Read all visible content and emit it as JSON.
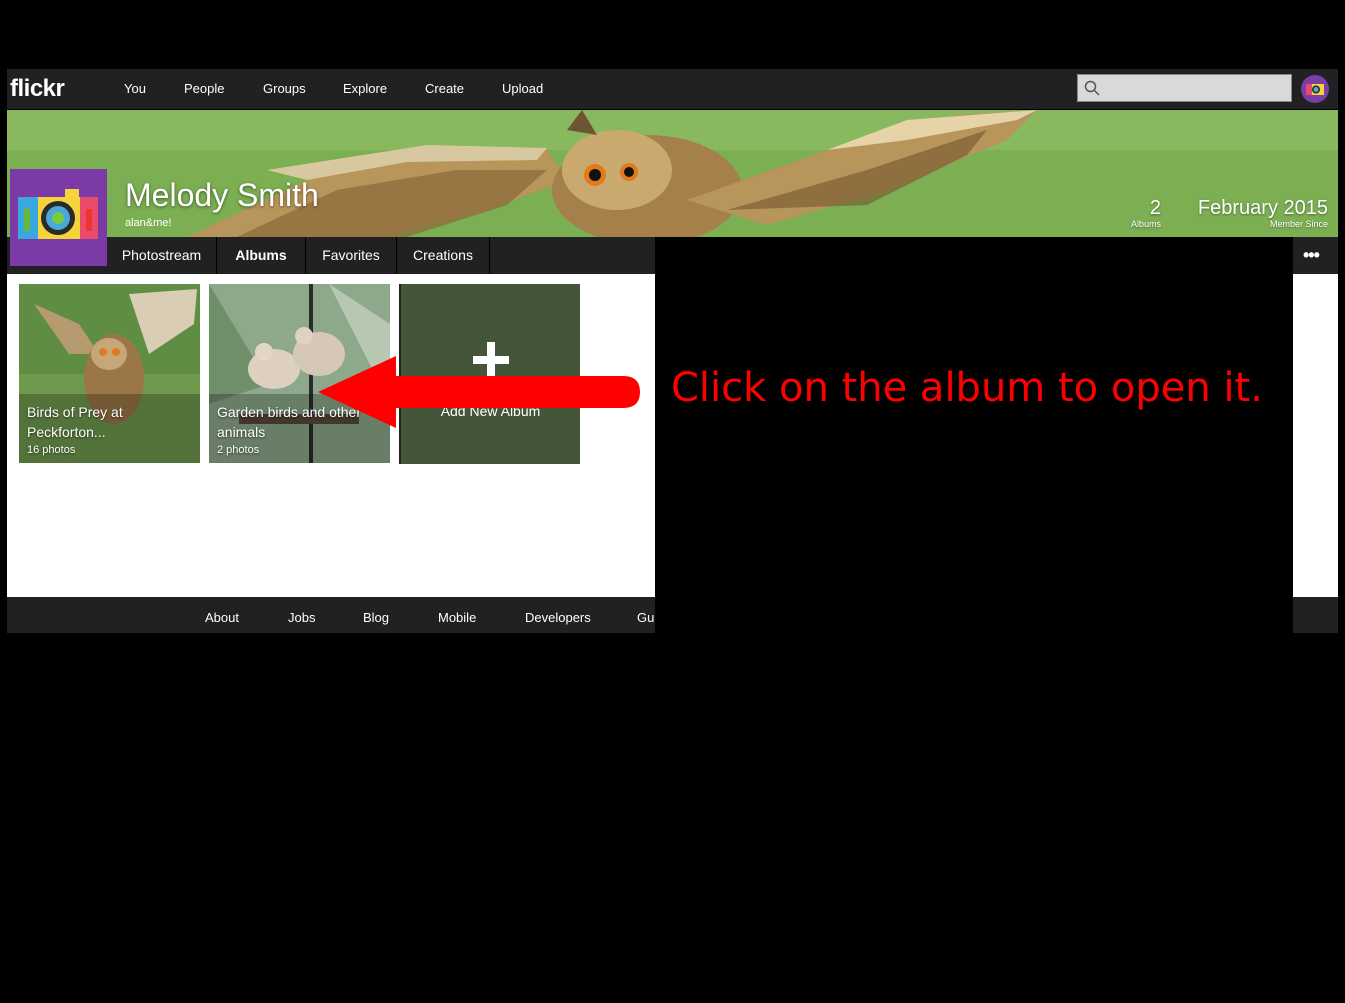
{
  "app": {
    "logo": "flickr",
    "nav": [
      "You",
      "People",
      "Groups",
      "Explore",
      "Create",
      "Upload"
    ],
    "search_placeholder": ""
  },
  "profile": {
    "name": "Melody Smith",
    "handle": "alan&me!",
    "stats": [
      {
        "value": "2",
        "label": "Albums"
      },
      {
        "value": "February 2015",
        "label": "Member Since"
      }
    ]
  },
  "subnav": {
    "items": [
      "Photostream",
      "Albums",
      "Favorites",
      "Creations"
    ],
    "active": "Albums",
    "more": "•••"
  },
  "albums": [
    {
      "title_line1": "Birds of Prey at",
      "title_line2": "Peckforton...",
      "count": "16 photos"
    },
    {
      "title_line1": "Garden birds and other",
      "title_line2": "animals",
      "count": "2 photos"
    }
  ],
  "add_album": {
    "label": "Add New Album"
  },
  "footer": [
    "About",
    "Jobs",
    "Blog",
    "Mobile",
    "Developers",
    "Gui"
  ],
  "annotation": {
    "text": "Click on the album to open it.",
    "color": "#ff0000"
  },
  "colors": {
    "navbar": "#212124",
    "avatar_purple": "#7b3aa6",
    "add_album_bg": "#45553a"
  }
}
